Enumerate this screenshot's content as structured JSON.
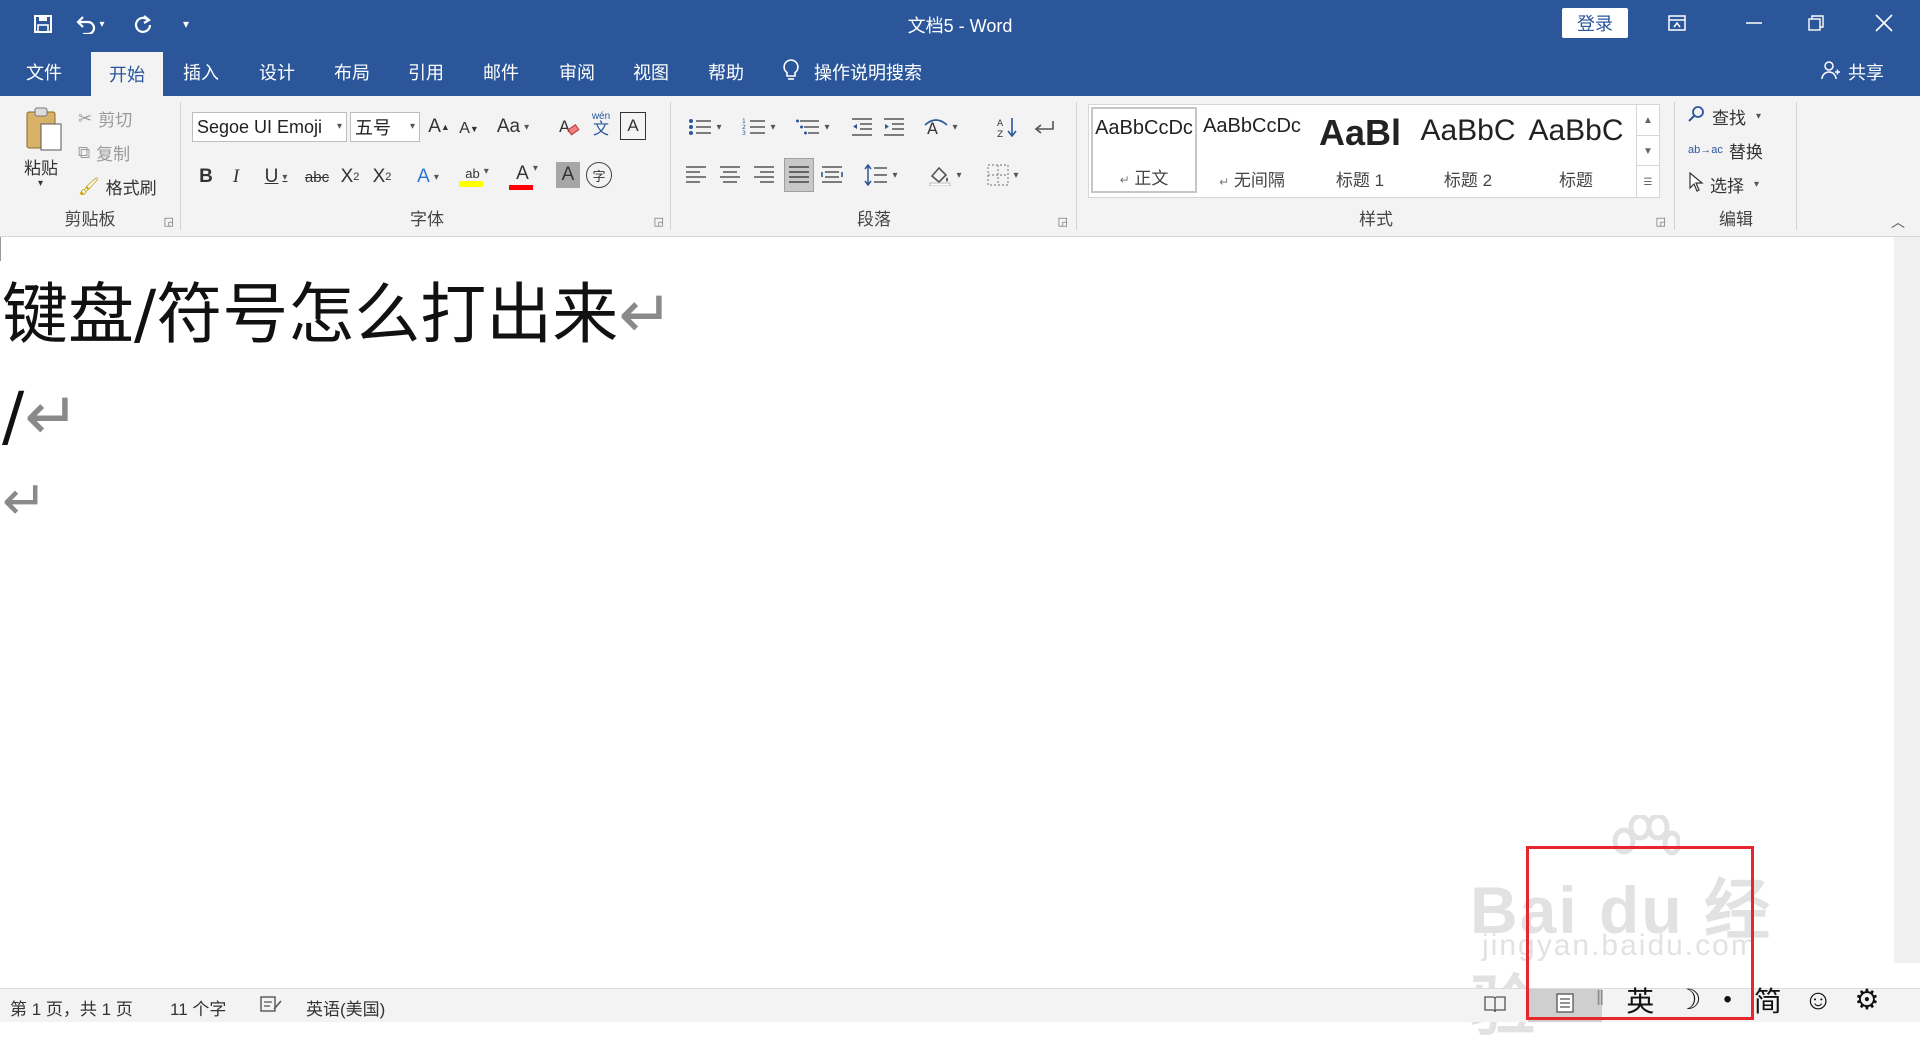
{
  "app": {
    "window_title": "文档5  -  Word",
    "login_label": "登录",
    "share_label": "共享"
  },
  "tabs": [
    "文件",
    "开始",
    "插入",
    "设计",
    "布局",
    "引用",
    "邮件",
    "审阅",
    "视图",
    "帮助"
  ],
  "active_tab": "开始",
  "tell_me": "操作说明搜索",
  "ribbon": {
    "clipboard": {
      "label": "剪贴板",
      "paste": "粘贴",
      "cut": "剪切",
      "copy": "复制",
      "format_painter": "格式刷"
    },
    "font": {
      "label": "字体",
      "font_name": "Segoe UI Emoji",
      "font_size": "五号",
      "grow": "A",
      "shrink": "A",
      "change_case": "Aa",
      "phonetic_top": "wén",
      "phonetic_bottom": "文",
      "char_border": "A",
      "bold": "B",
      "italic": "I",
      "underline": "U",
      "strikethrough": "abc",
      "subscript": "X",
      "subscript_mark": "2",
      "superscript": "X",
      "superscript_mark": "2",
      "text_effects": "A",
      "highlight": "ab",
      "font_color": "A",
      "char_shading": "A",
      "enclose": "字"
    },
    "paragraph": {
      "label": "段落"
    },
    "styles": {
      "label": "样式",
      "items": [
        {
          "sample": "AaBbCcDc",
          "name": "正文",
          "mark": "↵"
        },
        {
          "sample": "AaBbCcDc",
          "name": "无间隔",
          "mark": "↵"
        },
        {
          "sample": "AaBl",
          "name": "标题 1",
          "mark": ""
        },
        {
          "sample": "AaBbC",
          "name": "标题 2",
          "mark": ""
        },
        {
          "sample": "AaBbC",
          "name": "标题",
          "mark": ""
        }
      ]
    },
    "editing": {
      "label": "编辑",
      "find": "查找",
      "replace": "替换",
      "select": "选择",
      "replace_icon": "ab→ac"
    }
  },
  "document": {
    "paragraphs": [
      "键盘/符号怎么打出来",
      "/",
      ""
    ],
    "para_mark": "↵"
  },
  "status": {
    "page": "第 1 页，共 1 页",
    "words": "11 个字",
    "language": "英语(美国)"
  },
  "ime": {
    "lang": "英",
    "moon": "☽",
    "dot": "•",
    "jian": "简",
    "smile": "☺",
    "gear": "⚙"
  },
  "watermark": {
    "main": "Bai du 经验",
    "sub": "jingyan.baidu.com"
  },
  "colors": {
    "brand": "#2b579a",
    "highlight_box": "#e8262e",
    "highlight_yellow": "#ffff00",
    "font_red": "#ff0000"
  }
}
